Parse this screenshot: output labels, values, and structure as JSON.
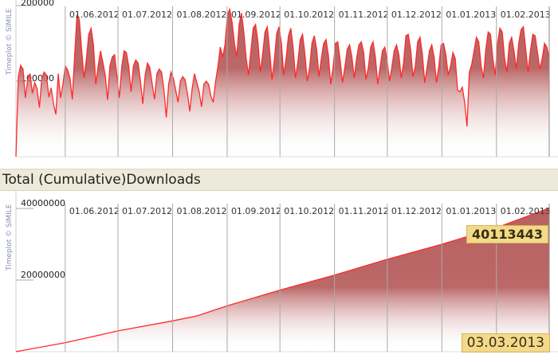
{
  "credit": "Timeplot © SIMILE",
  "section_title": "Total (Cumulative)Downloads",
  "info": {
    "value": "40113443",
    "date": "03.03.2013"
  },
  "colors": {
    "line": "#ff2a2a",
    "fill_top": "#b86060",
    "grid": "#aaaaaa"
  },
  "chart_data": [
    {
      "type": "area",
      "title": "",
      "ylim": [
        0,
        200000
      ],
      "xlim": [
        "2012-05-04",
        "2013-03-03"
      ],
      "y_tick_labels": [
        "200000",
        "100000"
      ],
      "y_tick_values": [
        200000,
        100000
      ],
      "x_tick_labels": [
        "01.06.2012",
        "01.07.2012",
        "01.08.2012",
        "01.09.2012",
        "01.10.2012",
        "01.11.2012",
        "01.12.2012",
        "01.01.2013",
        "01.02.2013"
      ],
      "x_tick_dates": [
        "2012-06-01",
        "2012-07-01",
        "2012-08-01",
        "2012-09-01",
        "2012-10-01",
        "2012-11-01",
        "2012-12-01",
        "2013-01-01",
        "2013-02-01"
      ],
      "grid": true,
      "x_start": "2012-05-04",
      "series": [
        {
          "values": [
            0,
            105000,
            121000,
            116000,
            78000,
            102000,
            110000,
            84000,
            98000,
            90000,
            65000,
            104000,
            112000,
            108000,
            79000,
            91000,
            70000,
            56000,
            110000,
            78000,
            96000,
            120000,
            115000,
            104000,
            76000,
            135000,
            188000,
            181000,
            140000,
            104000,
            130000,
            162000,
            170000,
            148000,
            96000,
            120000,
            140000,
            125000,
            108000,
            75000,
            120000,
            132000,
            135000,
            106000,
            78000,
            118000,
            140000,
            138000,
            120000,
            86000,
            120000,
            128000,
            124000,
            100000,
            70000,
            108000,
            124000,
            118000,
            96000,
            76000,
            110000,
            116000,
            112000,
            88000,
            52000,
            96000,
            112000,
            104000,
            88000,
            72000,
            100000,
            106000,
            102000,
            84000,
            60000,
            90000,
            110000,
            98000,
            86000,
            66000,
            96000,
            100000,
            96000,
            80000,
            72000,
            100000,
            120000,
            145000,
            132000,
            148000,
            188000,
            195000,
            178000,
            150000,
            132000,
            175000,
            190000,
            165000,
            130000,
            108000,
            140000,
            170000,
            175000,
            152000,
            112000,
            135000,
            165000,
            172000,
            140000,
            102000,
            128000,
            163000,
            172000,
            150000,
            108000,
            130000,
            160000,
            170000,
            144000,
            104000,
            125000,
            155000,
            162000,
            136000,
            100000,
            118000,
            150000,
            160000,
            142000,
            106000,
            130000,
            150000,
            155000,
            134000,
            96000,
            118000,
            150000,
            152000,
            128000,
            98000,
            118000,
            142000,
            148000,
            132000,
            104000,
            130000,
            148000,
            152000,
            138000,
            102000,
            118000,
            145000,
            152000,
            132000,
            96000,
            118000,
            140000,
            145000,
            128000,
            100000,
            118000,
            140000,
            148000,
            135000,
            104000,
            124000,
            160000,
            162000,
            142000,
            106000,
            120000,
            152000,
            158000,
            136000,
            98000,
            118000,
            140000,
            148000,
            132000,
            98000,
            120000,
            148000,
            150000,
            135000,
            108000,
            120000,
            138000,
            130000,
            88000,
            86000,
            92000,
            72000,
            40000,
            112000,
            122000,
            140000,
            158000,
            152000,
            120000,
            104000,
            142000,
            165000,
            162000,
            130000,
            108000,
            150000,
            170000,
            165000,
            130000,
            112000,
            150000,
            158000,
            140000,
            116000,
            150000,
            168000,
            172000,
            142000,
            112000,
            140000,
            162000,
            160000,
            138000,
            116000,
            130000,
            150000,
            145000,
            130000
          ]
        }
      ]
    },
    {
      "type": "area",
      "title": "Total (Cumulative)Downloads",
      "ylim": [
        0,
        40000000
      ],
      "xlim": [
        "2012-05-04",
        "2013-03-03"
      ],
      "y_tick_labels": [
        "40000000",
        "20000000"
      ],
      "y_tick_values": [
        40000000,
        20000000
      ],
      "x_tick_labels": [
        "01.06.2012",
        "01.07.2012",
        "01.08.2012",
        "01.09.2012",
        "01.10.2012",
        "01.11.2012",
        "01.12.2012",
        "01.01.2013",
        "01.02.2013"
      ],
      "x_tick_dates": [
        "2012-06-01",
        "2012-07-01",
        "2012-08-01",
        "2012-09-01",
        "2012-10-01",
        "2012-11-01",
        "2012-12-01",
        "2013-01-01",
        "2013-02-01"
      ],
      "grid": true,
      "series": [
        {
          "x": [
            "2012-05-04",
            "2012-06-01",
            "2012-07-01",
            "2012-08-01",
            "2012-08-15",
            "2012-09-01",
            "2012-10-01",
            "2012-11-01",
            "2012-12-01",
            "2013-01-01",
            "2013-02-01",
            "2013-03-03"
          ],
          "values": [
            0,
            2500000,
            5800000,
            8600000,
            10000000,
            12800000,
            17200000,
            21400000,
            25800000,
            30000000,
            34600000,
            40113443
          ]
        }
      ]
    }
  ]
}
